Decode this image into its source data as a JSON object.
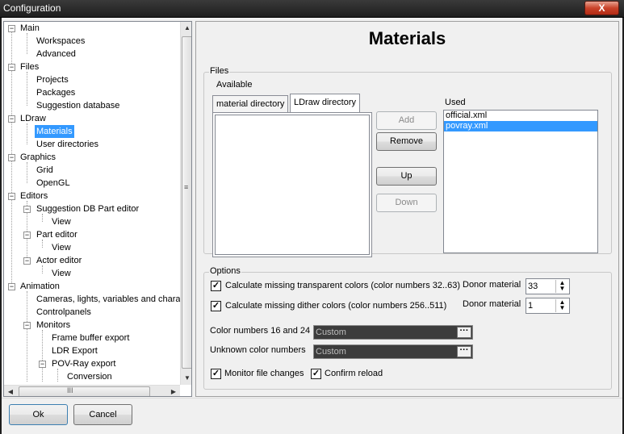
{
  "window": {
    "title": "Configuration",
    "close_label": "X"
  },
  "tree": {
    "items": [
      {
        "label": "Main"
      },
      {
        "label": "Workspaces"
      },
      {
        "label": "Advanced"
      },
      {
        "label": "Files"
      },
      {
        "label": "Projects"
      },
      {
        "label": "Packages"
      },
      {
        "label": "Suggestion database"
      },
      {
        "label": "LDraw"
      },
      {
        "label": "Materials"
      },
      {
        "label": "User directories"
      },
      {
        "label": "Graphics"
      },
      {
        "label": "Grid"
      },
      {
        "label": "OpenGL"
      },
      {
        "label": "Editors"
      },
      {
        "label": "Suggestion DB Part editor"
      },
      {
        "label": "View"
      },
      {
        "label": "Part editor"
      },
      {
        "label": "View"
      },
      {
        "label": "Actor editor"
      },
      {
        "label": "View"
      },
      {
        "label": "Animation"
      },
      {
        "label": "Cameras, lights, variables and chara"
      },
      {
        "label": "Controlpanels"
      },
      {
        "label": "Monitors"
      },
      {
        "label": "Frame buffer export"
      },
      {
        "label": "LDR Export"
      },
      {
        "label": "POV-Ray export"
      },
      {
        "label": "Conversion"
      }
    ],
    "selected": "Materials",
    "grip_v": "≡",
    "grip_h": "III"
  },
  "page": {
    "title": "Materials",
    "files_group": "Files",
    "available_label": "Available",
    "tabs": [
      {
        "label": "material directory"
      },
      {
        "label": "LDraw directory"
      }
    ],
    "used_label": "Used",
    "used_items": [
      {
        "label": "official.xml"
      },
      {
        "label": "povray.xml"
      }
    ],
    "used_selected": "povray.xml",
    "buttons": {
      "add": "Add",
      "remove": "Remove",
      "up": "Up",
      "down": "Down"
    },
    "options_group": "Options",
    "opt_transparent": "Calculate missing transparent colors (color numbers 32..63)",
    "opt_dither": "Calculate missing dither colors (color numbers 256..511)",
    "donor_label_1": "Donor material",
    "donor_value_1": "33",
    "donor_label_2": "Donor material",
    "donor_value_2": "1",
    "color_16_24_label": "Color numbers 16 and 24",
    "color_16_24_value": "Custom",
    "unknown_label": "Unknown color numbers",
    "unknown_value": "Custom",
    "monitor_label": "Monitor file changes",
    "confirm_label": "Confirm reload",
    "ellipsis": "···",
    "check_mark": "✓"
  },
  "footer": {
    "ok": "Ok",
    "cancel": "Cancel"
  }
}
